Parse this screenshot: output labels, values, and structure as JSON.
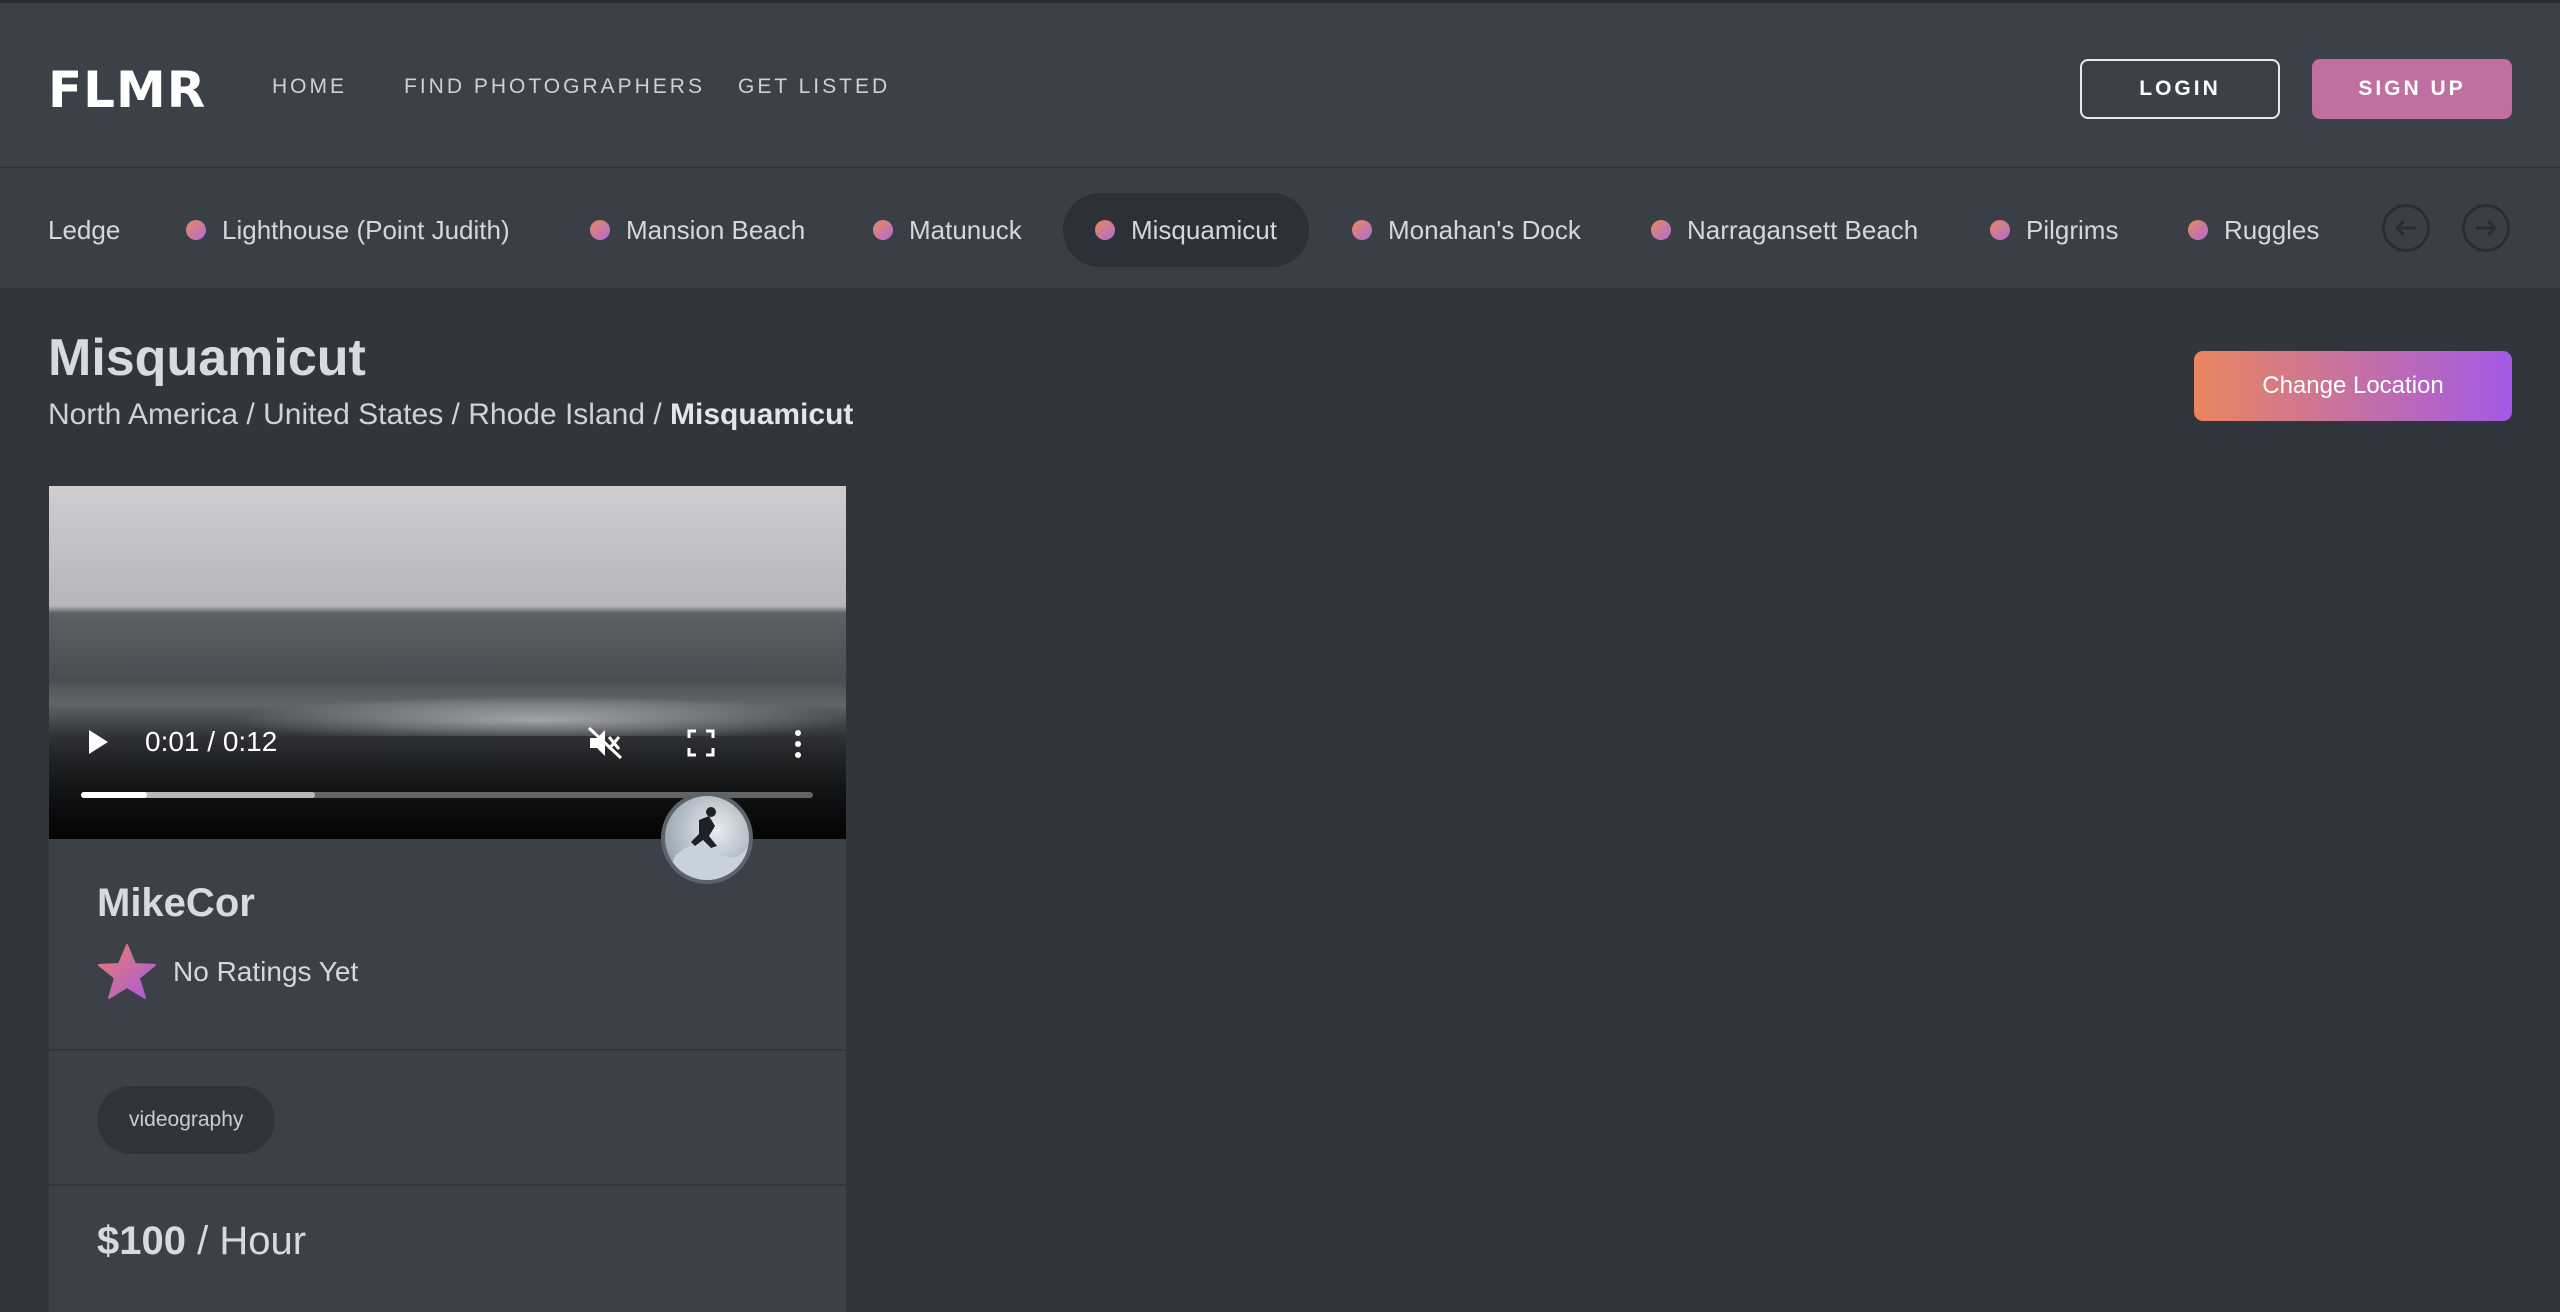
{
  "header": {
    "logo": "FLMR",
    "nav": [
      "HOME",
      "FIND PHOTOGRAPHERS",
      "GET LISTED"
    ],
    "login_label": "LOGIN",
    "signup_label": "SIGN UP"
  },
  "locations": {
    "items": [
      "Ledge",
      "Lighthouse (Point Judith)",
      "Mansion Beach",
      "Matunuck",
      "Misquamicut",
      "Monahan's Dock",
      "Narragansett Beach",
      "Pilgrims",
      "Ruggles"
    ],
    "active": "Misquamicut"
  },
  "page": {
    "title": "Misquamicut",
    "breadcrumb": [
      "North America",
      "United States",
      "Rhode Island"
    ],
    "breadcrumb_current": "Misquamicut",
    "change_location_label": "Change Location"
  },
  "card": {
    "video": {
      "time": "0:01 / 0:12",
      "played_fraction": 0.09,
      "buffered_fraction": 0.32
    },
    "name": "MikeCor",
    "rating_text": "No Ratings Yet",
    "tag": "videography",
    "price_amount": "$100",
    "price_unit": "/ Hour"
  },
  "colors": {
    "background": "#31353d",
    "header": "#3c4149",
    "signup": "#c16fa0",
    "gradient_start": "#e9865f",
    "gradient_end": "#a35ae6"
  }
}
